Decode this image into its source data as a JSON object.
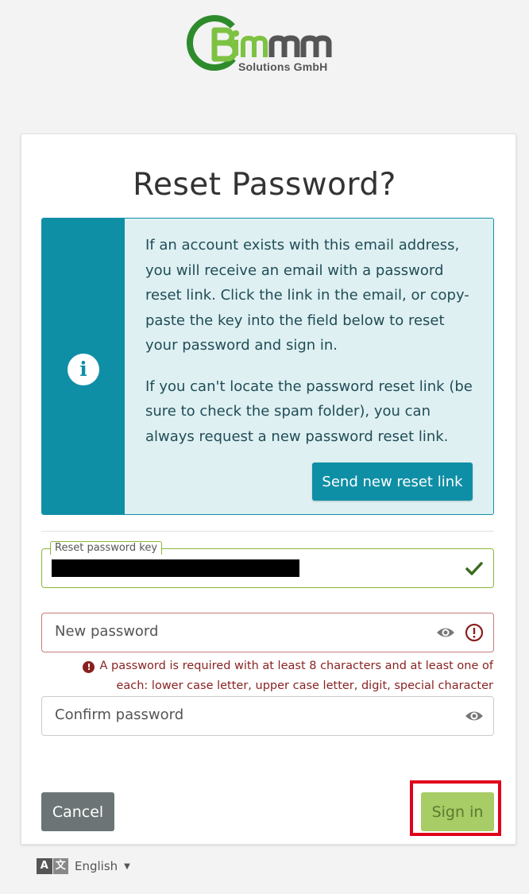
{
  "logo": {
    "brand_short": "BiMM",
    "brand_sub": "Solutions GmbH",
    "accent": "#3a9a2c"
  },
  "page": {
    "title": "Reset Password?"
  },
  "info": {
    "paragraph1": "If an account exists with this email address, you will receive an email with a password reset link. Click the link in the email, or copy-paste the key into the field below to reset your password and sign in.",
    "paragraph2": "If you can't locate the password reset link (be sure to check the spam folder), you can always request a new password reset link.",
    "button_label": "Send new reset link",
    "icon": "info-icon",
    "color": "#0f8fa6"
  },
  "form": {
    "reset_key": {
      "label": "Reset password key",
      "status": "valid",
      "icon": "check-icon"
    },
    "new_password": {
      "placeholder": "New password",
      "status": "invalid",
      "error": "A password is required with at least 8 characters and at least one of each: lower case letter, upper case letter, digit, special character"
    },
    "confirm_password": {
      "placeholder": "Confirm password"
    }
  },
  "actions": {
    "cancel_label": "Cancel",
    "signin_label": "Sign in"
  },
  "language": {
    "current": "English",
    "icon": "translate-icon"
  }
}
